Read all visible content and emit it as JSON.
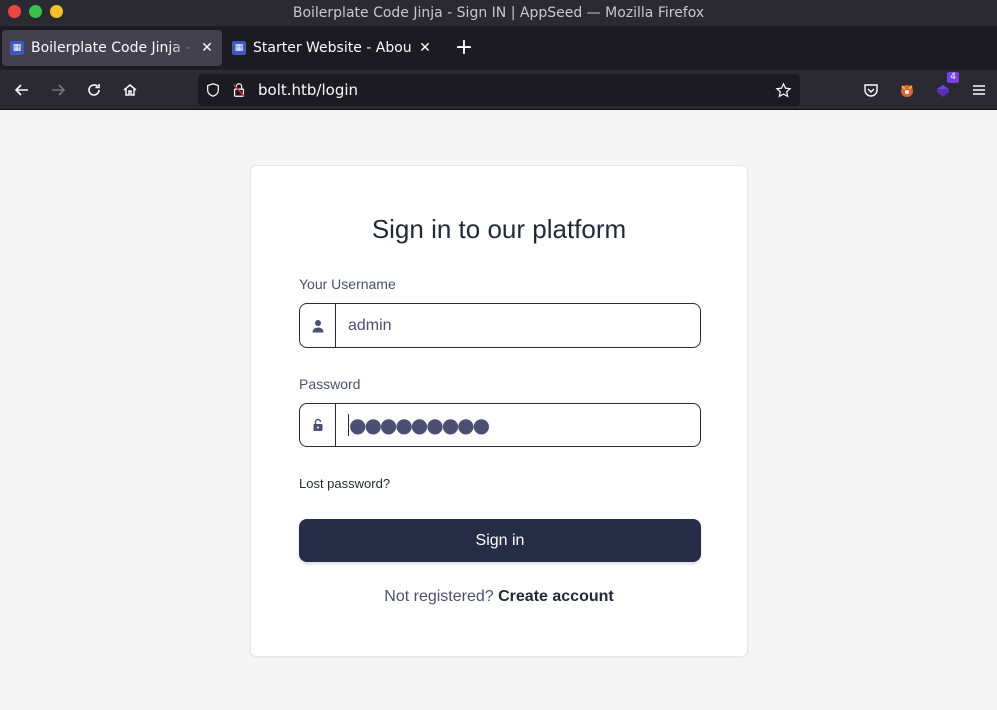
{
  "window": {
    "title": "Boilerplate Code Jinja - Sign IN | AppSeed — Mozilla Firefox"
  },
  "tabs": [
    {
      "label": "Boilerplate Code Jinja - Sign IN | AppSeed",
      "active": true,
      "close": "✕"
    },
    {
      "label": "Starter Website - About",
      "active": false,
      "close": "✕"
    }
  ],
  "new_tab_label": "+",
  "navbar": {
    "url": "bolt.htb/login",
    "extension_badge": "4"
  },
  "login": {
    "title": "Sign in to our platform",
    "username_label": "Your Username",
    "username_value": "admin",
    "password_label": "Password",
    "password_mask": "●●●●●●●●●",
    "lost_password": "Lost password?",
    "submit_label": "Sign in",
    "not_registered": "Not registered?",
    "create_account": "Create account"
  },
  "colors": {
    "accent": "#262b46",
    "browser_chrome": "#2b2a33",
    "tab_strip": "#1c1b22"
  },
  "icons": {
    "username_addon": "user-icon",
    "password_addon": "unlock-icon"
  }
}
